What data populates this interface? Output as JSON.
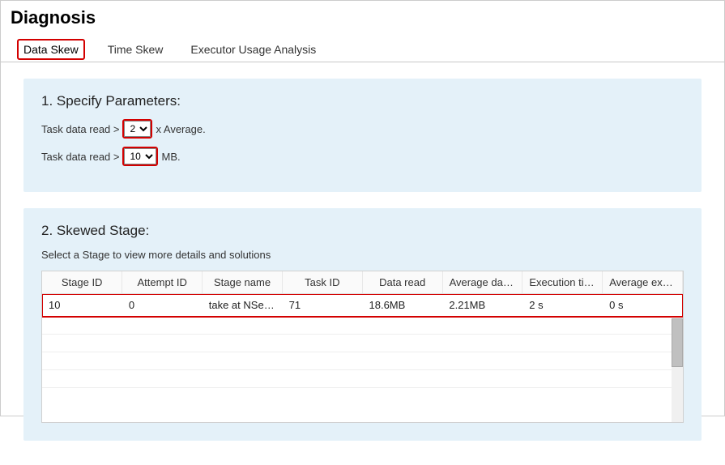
{
  "page_title": "Diagnosis",
  "tabs": [
    {
      "label": "Data Skew",
      "active": true
    },
    {
      "label": "Time Skew",
      "active": false
    },
    {
      "label": "Executor Usage Analysis",
      "active": false
    }
  ],
  "section1": {
    "title": "1. Specify Parameters:",
    "param1_prefix": "Task data read >",
    "param1_value": "2",
    "param1_suffix": "x Average.",
    "param2_prefix": "Task data read >",
    "param2_value": "10",
    "param2_suffix": "MB."
  },
  "section2": {
    "title": "2. Skewed Stage:",
    "subtitle": "Select a Stage to view more details and solutions",
    "columns": [
      "Stage ID",
      "Attempt ID",
      "Stage name",
      "Task ID",
      "Data read",
      "Average dat…",
      "Execution time",
      "Average exe…"
    ],
    "rows": [
      {
        "stage_id": "10",
        "attempt_id": "0",
        "stage_name": "take at NSer…",
        "task_id": "71",
        "data_read": "18.6MB",
        "avg_data": "2.21MB",
        "exec_time": "2 s",
        "avg_exec": "0 s"
      }
    ]
  }
}
